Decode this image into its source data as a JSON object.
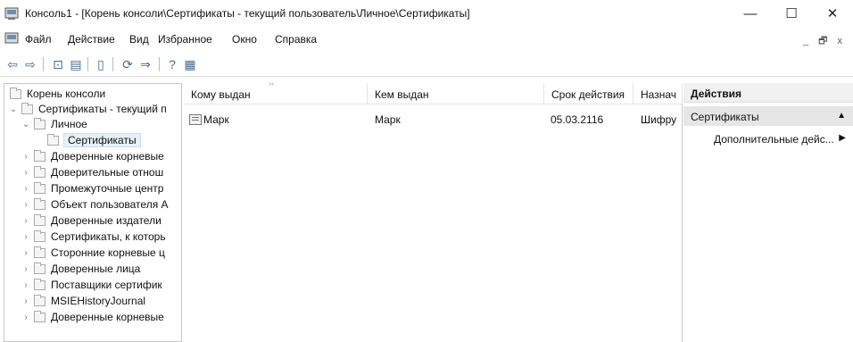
{
  "window": {
    "title": "Консоль1 - [Корень консоли\\Сертификаты - текущий пользователь\\Личное\\Сертификаты]",
    "min_glyph": "—",
    "max_glyph": "☐",
    "close_glyph": "✕"
  },
  "menu": {
    "items": [
      "Файл",
      "Действие",
      "Вид",
      "Избранное",
      "Окно",
      "Справка"
    ],
    "child_buttons": "_ 🗗 x"
  },
  "toolbar": {
    "icons": [
      "back-icon",
      "forward-icon",
      "up-icon",
      "show-tree-icon",
      "properties-icon",
      "refresh-icon",
      "export-icon",
      "help-icon",
      "action-pane-icon"
    ]
  },
  "tree": {
    "root": "Корень консоли",
    "store": "Сертификаты - текущий п",
    "personal": "Личное",
    "selected": "Сертификаты",
    "items": [
      "Доверенные корневые",
      "Доверительные отнош",
      "Промежуточные центр",
      "Объект пользователя А",
      "Доверенные издатели",
      "Сертификаты, к которь",
      "Сторонние корневые ц",
      "Доверенные лица",
      "Поставщики сертифик",
      "MSIEHistoryJournal",
      "Доверенные корневые"
    ]
  },
  "list": {
    "headers": [
      "Кому выдан",
      "Кем выдан",
      "Срок действия",
      "Назнач"
    ],
    "rows": [
      {
        "issued_to": "Марк",
        "issued_by": "Марк",
        "expiration": "05.03.2116",
        "purpose": "Шифру"
      }
    ]
  },
  "actions": {
    "title": "Действия",
    "section": "Сертификаты",
    "more": "Дополнительные дейс..."
  }
}
